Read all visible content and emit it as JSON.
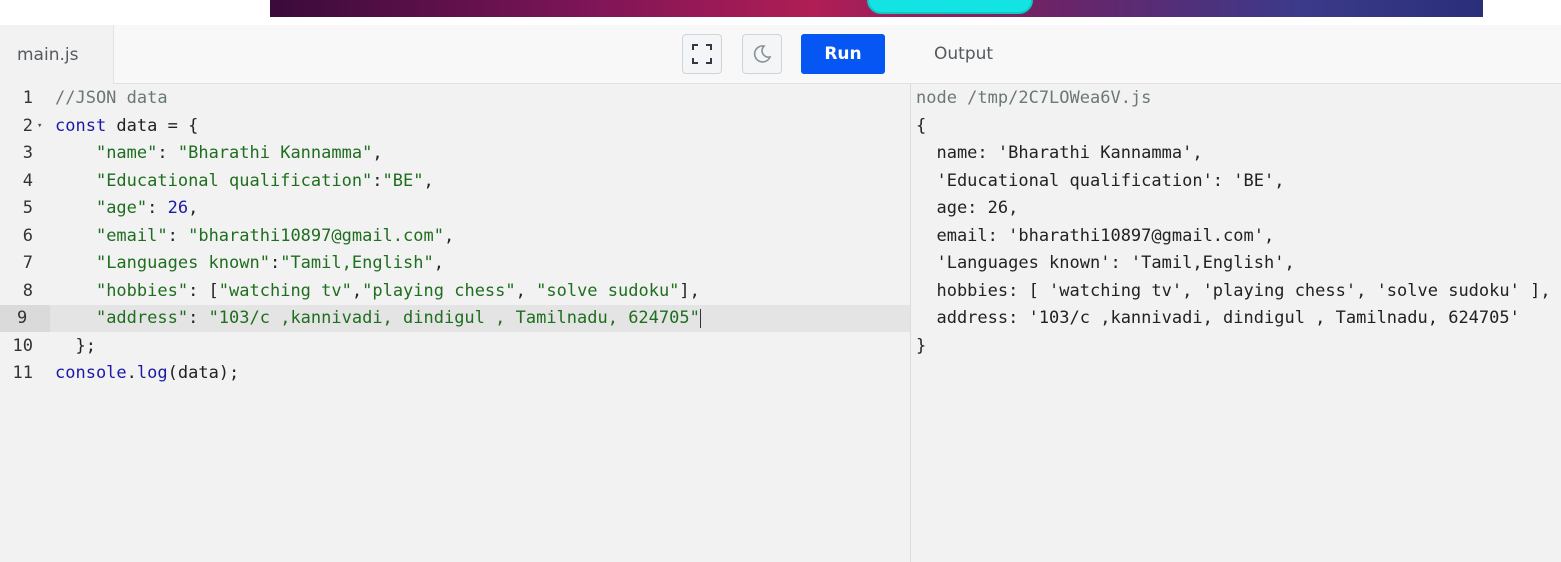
{
  "editor": {
    "file_tab": "main.js",
    "run_label": "Run",
    "icons": {
      "fullscreen": "fullscreen-icon",
      "theme": "moon-icon"
    },
    "lines": [
      {
        "num": "1",
        "fold": "",
        "segments": [
          {
            "cls": "c-comment",
            "text": "//JSON data"
          }
        ]
      },
      {
        "num": "2",
        "fold": "▾",
        "segments": [
          {
            "cls": "c-kw",
            "text": "const"
          },
          {
            "cls": "c-plain",
            "text": " data = {"
          }
        ]
      },
      {
        "num": "3",
        "fold": "",
        "segments": [
          {
            "cls": "c-plain",
            "text": "    "
          },
          {
            "cls": "c-str",
            "text": "\"name\""
          },
          {
            "cls": "c-plain",
            "text": ": "
          },
          {
            "cls": "c-str",
            "text": "\"Bharathi Kannamma\""
          },
          {
            "cls": "c-plain",
            "text": ","
          }
        ]
      },
      {
        "num": "4",
        "fold": "",
        "segments": [
          {
            "cls": "c-plain",
            "text": "    "
          },
          {
            "cls": "c-str",
            "text": "\"Educational qualification\""
          },
          {
            "cls": "c-plain",
            "text": ":"
          },
          {
            "cls": "c-str",
            "text": "\"BE\""
          },
          {
            "cls": "c-plain",
            "text": ","
          }
        ]
      },
      {
        "num": "5",
        "fold": "",
        "segments": [
          {
            "cls": "c-plain",
            "text": "    "
          },
          {
            "cls": "c-str",
            "text": "\"age\""
          },
          {
            "cls": "c-plain",
            "text": ": "
          },
          {
            "cls": "c-num",
            "text": "26"
          },
          {
            "cls": "c-plain",
            "text": ","
          }
        ]
      },
      {
        "num": "6",
        "fold": "",
        "segments": [
          {
            "cls": "c-plain",
            "text": "    "
          },
          {
            "cls": "c-str",
            "text": "\"email\""
          },
          {
            "cls": "c-plain",
            "text": ": "
          },
          {
            "cls": "c-str",
            "text": "\"bharathi10897@gmail.com\""
          },
          {
            "cls": "c-plain",
            "text": ","
          }
        ]
      },
      {
        "num": "7",
        "fold": "",
        "segments": [
          {
            "cls": "c-plain",
            "text": "    "
          },
          {
            "cls": "c-str",
            "text": "\"Languages known\""
          },
          {
            "cls": "c-plain",
            "text": ":"
          },
          {
            "cls": "c-str",
            "text": "\"Tamil,English\""
          },
          {
            "cls": "c-plain",
            "text": ","
          }
        ]
      },
      {
        "num": "8",
        "fold": "",
        "segments": [
          {
            "cls": "c-plain",
            "text": "    "
          },
          {
            "cls": "c-str",
            "text": "\"hobbies\""
          },
          {
            "cls": "c-plain",
            "text": ": ["
          },
          {
            "cls": "c-str",
            "text": "\"watching tv\""
          },
          {
            "cls": "c-plain",
            "text": ","
          },
          {
            "cls": "c-str",
            "text": "\"playing chess\""
          },
          {
            "cls": "c-plain",
            "text": ", "
          },
          {
            "cls": "c-str",
            "text": "\"solve sudoku\""
          },
          {
            "cls": "c-plain",
            "text": "],"
          }
        ]
      },
      {
        "num": "9",
        "fold": "",
        "active": true,
        "segments": [
          {
            "cls": "c-plain",
            "text": "    "
          },
          {
            "cls": "c-str",
            "text": "\"address\""
          },
          {
            "cls": "c-plain",
            "text": ": "
          },
          {
            "cls": "c-str",
            "text": "\"103/c ,kannivadi, dindigul , Tamilnadu, 624705\""
          }
        ]
      },
      {
        "num": "10",
        "fold": "",
        "segments": [
          {
            "cls": "c-plain",
            "text": "  };"
          }
        ]
      },
      {
        "num": "11",
        "fold": "",
        "segments": [
          {
            "cls": "c-kw",
            "text": "console"
          },
          {
            "cls": "c-plain",
            "text": "."
          },
          {
            "cls": "c-kw",
            "text": "log"
          },
          {
            "cls": "c-plain",
            "text": "(data);"
          }
        ]
      }
    ]
  },
  "output": {
    "title": "Output",
    "command": "node /tmp/2C7LOWea6V.js",
    "lines": [
      "{",
      "  name: 'Bharathi Kannamma',",
      "  'Educational qualification': 'BE',",
      "  age: 26,",
      "  email: 'bharathi10897@gmail.com',",
      "  'Languages known': 'Tamil,English',",
      "  hobbies: [ 'watching tv', 'playing chess', 'solve sudoku' ],",
      "  address: '103/c ,kannivadi, dindigul , Tamilnadu, 624705'",
      "}"
    ]
  },
  "colors": {
    "run_button": "#0556f3",
    "comment": "#6a7a70",
    "keyword": "#1a1aa6",
    "string": "#1f6e1f"
  }
}
